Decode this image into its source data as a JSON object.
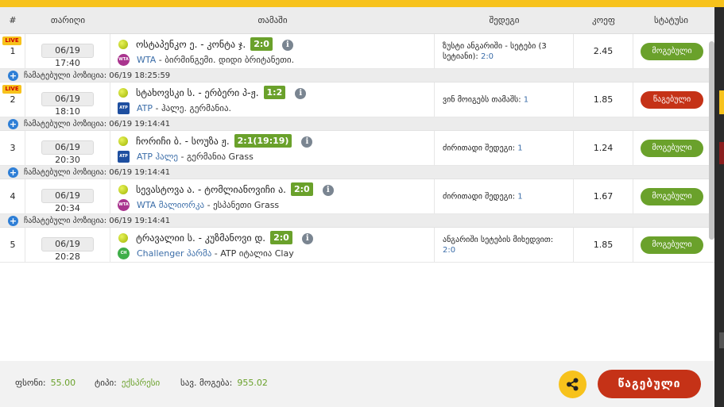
{
  "columns": {
    "number": "#",
    "date": "თარიღი",
    "game": "თამაში",
    "result": "შედეგი",
    "odd": "კოეფ",
    "status": "სტატუსი"
  },
  "live_label": "LIVE",
  "rows": [
    {
      "num": "1",
      "live": true,
      "date": "06/19 17:40",
      "players": "ოსტაპენკო ე. - კონტა ჯ.",
      "score": "2:0",
      "tour_logo": "WTA",
      "tour_logo_class": "wta",
      "tour_name": "WTA",
      "tour_rest": " - ბირმინგემი. დიდი ბრიტანეთი.",
      "result_label": "ზუსტი ანგარიში - სეტები (3 სეტიანი): ",
      "result_value": "2:0",
      "odd": "2.45",
      "status": "მოგებული",
      "status_type": "win",
      "placed_at": "ჩამატებული პოზიცია: 06/19 18:25:59"
    },
    {
      "num": "2",
      "live": true,
      "date": "06/19 18:10",
      "players": "სტახოვსკი ს. - ერბერი პ-ჟ.",
      "score": "1:2",
      "tour_logo": "ATP",
      "tour_logo_class": "atp",
      "tour_name": "ATP",
      "tour_rest": " - ჰალე. გერმანია.",
      "result_label": "ვინ მოიგებს თამაშს: ",
      "result_value": "1",
      "odd": "1.85",
      "status": "წაგებული",
      "status_type": "lose",
      "placed_at": "ჩამატებული პოზიცია: 06/19 19:14:41"
    },
    {
      "num": "3",
      "live": false,
      "date": "06/19 20:30",
      "players": "ჩორიჩი ბ. - სოუზა ჟ.",
      "score": "2:1(19:19)",
      "tour_logo": "ATP",
      "tour_logo_class": "atp",
      "tour_name": "ATP ჰალე",
      "tour_rest": " - გერმანია Grass",
      "result_label": "ძირითადი შედეგი: ",
      "result_value": "1",
      "odd": "1.24",
      "status": "მოგებული",
      "status_type": "win",
      "placed_at": "ჩამატებული პოზიცია: 06/19 19:14:41"
    },
    {
      "num": "4",
      "live": false,
      "date": "06/19 20:34",
      "players": "სევასტოვა ა. - ტომლიანოვიჩი ა.",
      "score": "2:0",
      "tour_logo": "WTA",
      "tour_logo_class": "wta",
      "tour_name": "WTA მალიორკა",
      "tour_rest": " - ესპანეთი Grass",
      "result_label": "ძირითადი შედეგი: ",
      "result_value": "1",
      "odd": "1.67",
      "status": "მოგებული",
      "status_type": "win",
      "placed_at": "ჩამატებული პოზიცია: 06/19 19:14:41"
    },
    {
      "num": "5",
      "live": false,
      "date": "06/19 20:28",
      "players": "ტრავალიი ს. - კუზმანოვი დ.",
      "score": "2:0",
      "tour_logo": "CH",
      "tour_logo_class": "ch",
      "tour_name": "Challenger პარმა",
      "tour_rest": " - ATP იტალია Clay",
      "result_label": "ანგარიში სეტების მიხედვით: ",
      "result_value": "2:0",
      "odd": "1.85",
      "status": "მოგებული",
      "status_type": "win",
      "placed_at": null
    }
  ],
  "footer": {
    "stake_label": "ფსონი:",
    "stake_value": "55.00",
    "type_label": "ტიპი:",
    "type_value": "ექსპრესი",
    "payout_label": "სავ. მოგება:",
    "payout_value": "955.02",
    "final_status": "წაგებული"
  },
  "icons": {
    "ball": "tennis-ball-icon",
    "info": "info-icon",
    "plus": "plus-circle-icon",
    "share": "share-icon"
  },
  "colors": {
    "accent_yellow": "#f7c21c",
    "win_green": "#6aa12b",
    "lose_red": "#c53217",
    "link_blue": "#3b6da8"
  }
}
